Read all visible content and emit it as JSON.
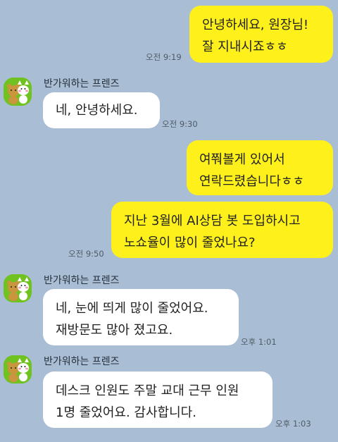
{
  "chat": {
    "sender_name": "반가워하는 프렌즈",
    "messages": [
      {
        "side": "mine",
        "text": "안녕하세요, 원장님!\n잘 지내시죠ㅎㅎ",
        "time": "오전 9:19"
      },
      {
        "side": "theirs",
        "text": "네, 안녕하세요.",
        "time": "오전 9:30"
      },
      {
        "side": "mine",
        "text": "여쭤볼게 있어서\n연락드렸습니다ㅎㅎ"
      },
      {
        "side": "mine",
        "text": "지난 3월에 AI상담 봇 도입하시고\n노쇼율이 많이 줄었나요?",
        "time": "오전 9:50"
      },
      {
        "side": "theirs",
        "text": "네, 눈에 띄게 많이 줄었어요.\n재방문도 많아 졌고요.",
        "time": "오후 1:01"
      },
      {
        "side": "theirs",
        "text": "데스크 인원도 주말 교대 근무 인원\n1명 줄었어요. 감사합니다.",
        "time": "오후 1:03"
      }
    ]
  },
  "colors": {
    "background": "#a9bdd4",
    "my_bubble": "#fef01b",
    "their_bubble": "#ffffff",
    "avatar_bg": "#6fc21f"
  },
  "icons": {
    "avatar": "friends-character-avatar-icon"
  }
}
